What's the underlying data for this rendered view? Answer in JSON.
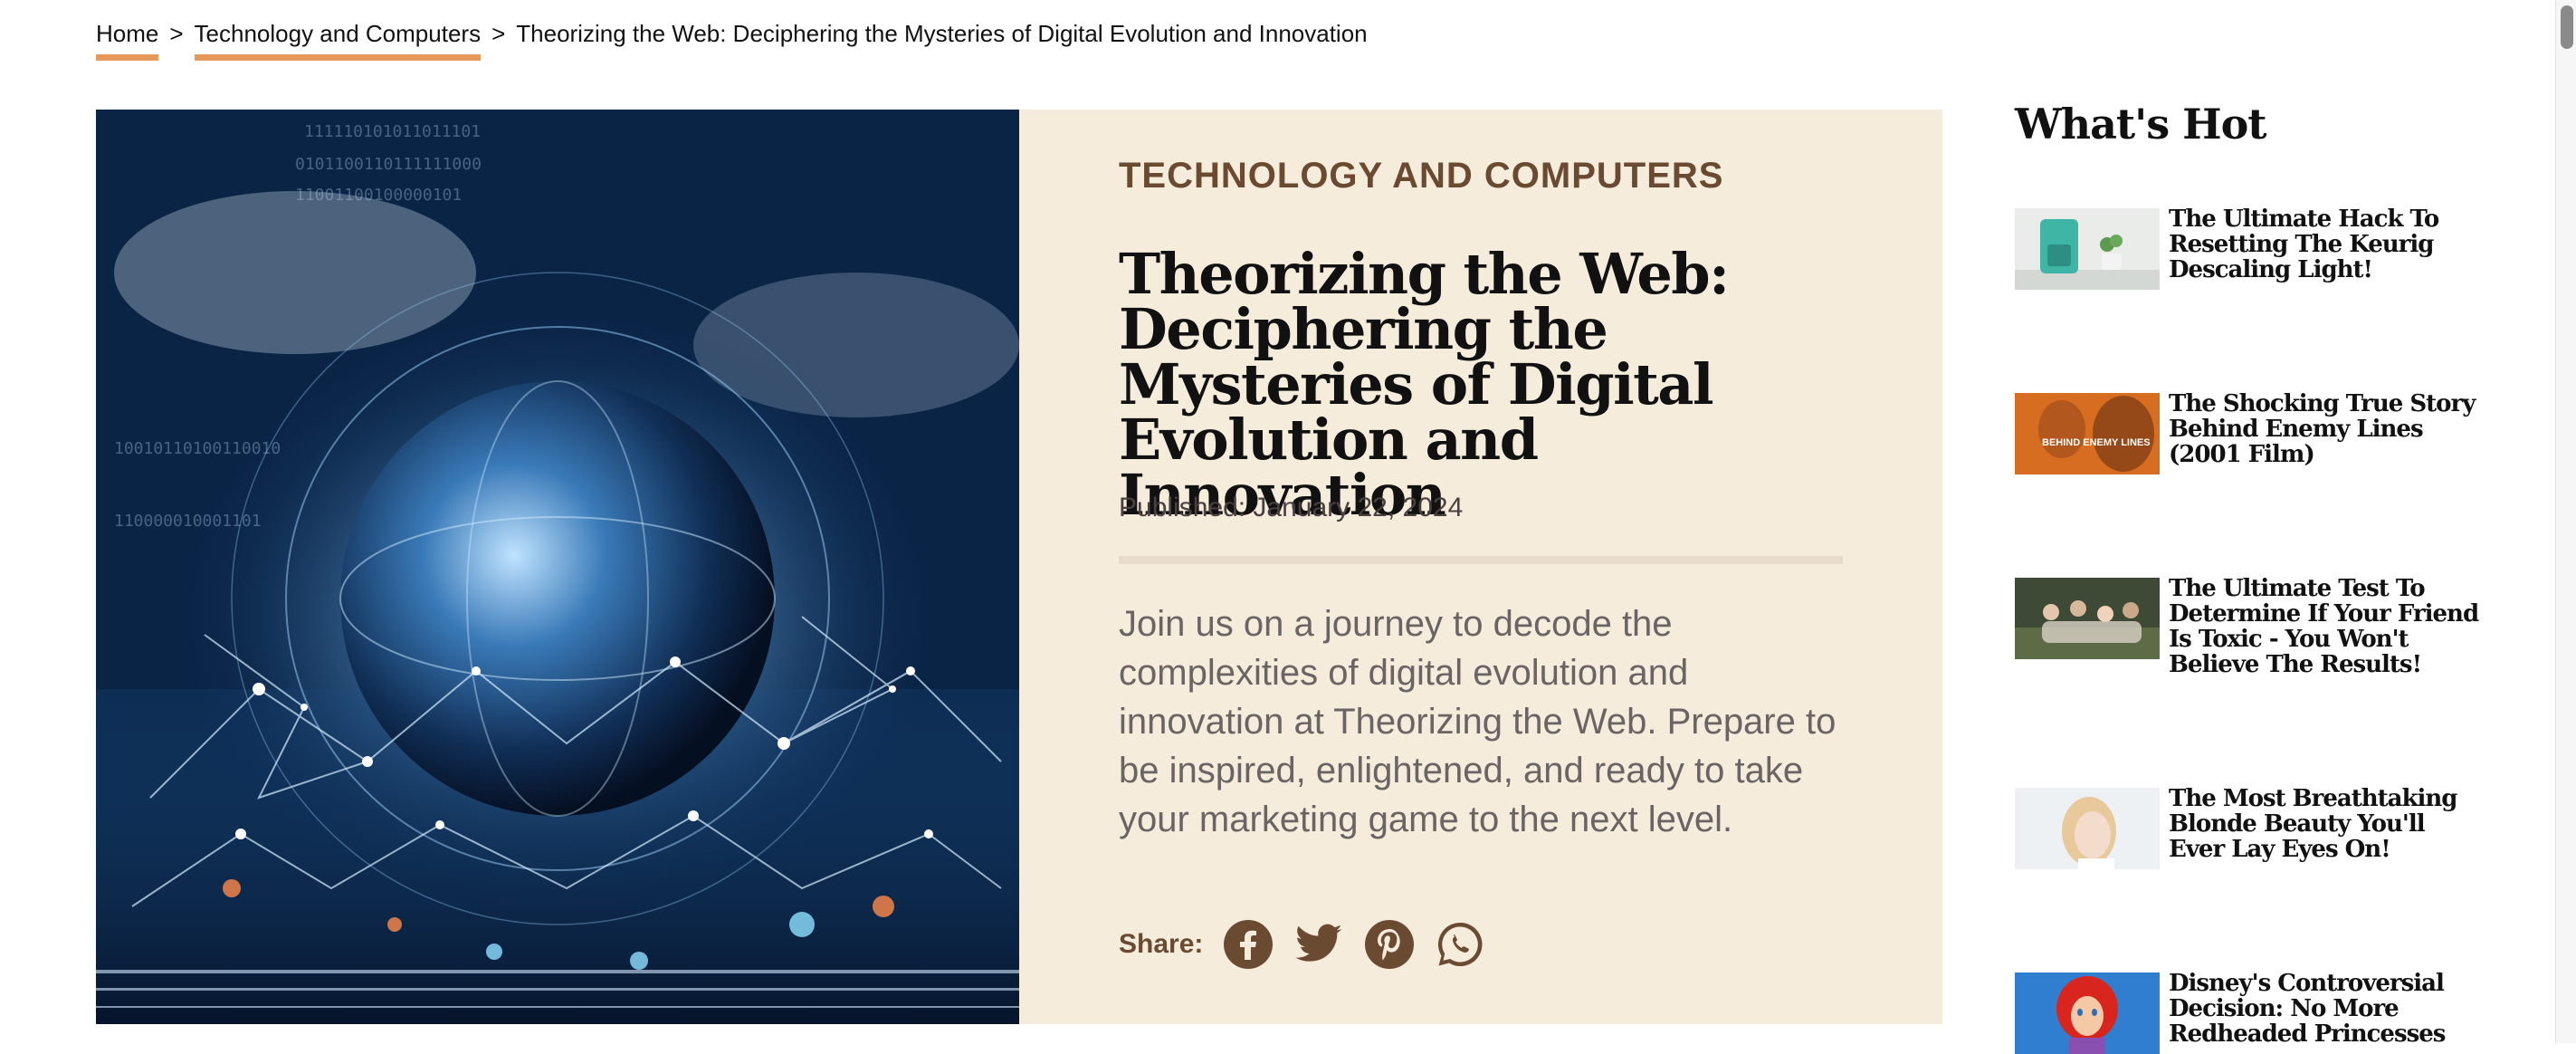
{
  "breadcrumb": {
    "home": "Home",
    "category": "Technology and Computers",
    "current": "Theorizing the Web: Deciphering the Mysteries of Digital Evolution and Innovation",
    "separator": ">"
  },
  "article": {
    "category": "TECHNOLOGY AND COMPUTERS",
    "title": "Theorizing the Web: Deciphering the Mysteries of Digital Evolution and Innovation",
    "published": "Published: January 22, 2024",
    "lead": "Join us on a journey to decode the complexities of digital evolution and innovation at Theorizing the Web. Prepare to be inspired, enlightened, and ready to take your marketing game to the next level.",
    "share_label": "Share:",
    "share_icons": [
      "facebook-icon",
      "twitter-icon",
      "pinterest-icon",
      "whatsapp-icon"
    ],
    "hero_image": "digital globe network illustration"
  },
  "sidebar": {
    "title": "What's Hot",
    "items": [
      {
        "title": "The Ultimate Hack To Resetting The Keurig Descaling Light!",
        "thumb": "keurig coffee maker"
      },
      {
        "title": "The Shocking True Story Behind Enemy Lines (2001 Film)",
        "thumb": "movie poster",
        "thumb_text": "BEHIND ENEMY LINES"
      },
      {
        "title": "The Ultimate Test To Determine If Your Friend Is Toxic - You Won't Believe The Results!",
        "thumb": "group of friends outdoors"
      },
      {
        "title": "The Most Breathtaking Blonde Beauty You'll Ever Lay Eyes On!",
        "thumb": "blonde woman portrait"
      },
      {
        "title": "Disney's Controversial Decision: No More Redheaded Princesses",
        "thumb": "red-haired princess cartoon"
      }
    ]
  },
  "colors": {
    "accent": "#e59a5c",
    "panel_bg": "#f5ecdc",
    "category_text": "#6b4a32"
  }
}
